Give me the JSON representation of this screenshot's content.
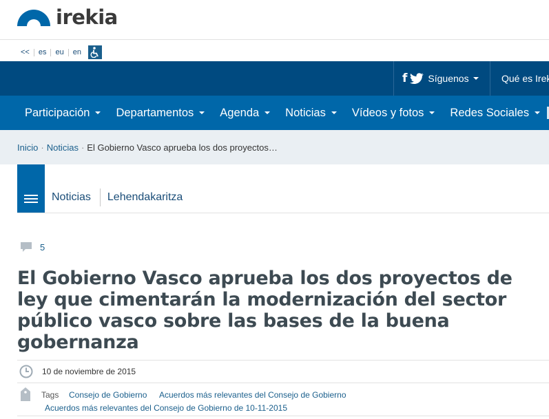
{
  "logo": {
    "text": "irekia",
    "icon": "irekia-logo-arc"
  },
  "languages": {
    "back": "<<",
    "items": [
      "es",
      "eu",
      "en"
    ],
    "accessibility_icon": "accessibility-icon"
  },
  "topbar": {
    "follow_label": "Síguenos",
    "social_icons": [
      "facebook-icon",
      "twitter-icon"
    ],
    "about_label": "Qué es Irek"
  },
  "nav": {
    "items": [
      "Participación",
      "Departamentos",
      "Agenda",
      "Noticias",
      "Vídeos y fotos",
      "Redes Sociales"
    ]
  },
  "breadcrumb": {
    "home": "Inicio",
    "section": "Noticias",
    "current": "El Gobierno Vasco aprueba los dos proyectos…"
  },
  "section_tabs": {
    "tabs": [
      "Noticias",
      "Lehendakaritza"
    ]
  },
  "article": {
    "comment_count": "5",
    "title": "El Gobierno Vasco aprueba los dos proyectos de ley que cimentarán la modernización del sector público vasco sobre las bases de la buena gobernanza",
    "date": "10 de noviembre de 2015",
    "tags_label": "Tags",
    "tags": [
      "Consejo de Gobierno",
      "Acuerdos más relevantes del Consejo de Gobierno",
      "Acuerdos más relevantes del Consejo de Gobierno de 10-11-2015"
    ]
  },
  "colors": {
    "topbar": "#004a80",
    "nav": "#0067a9",
    "breadcrumb_bg": "#eaeff3",
    "link": "#1a5f8c",
    "title": "#3d4a52"
  }
}
